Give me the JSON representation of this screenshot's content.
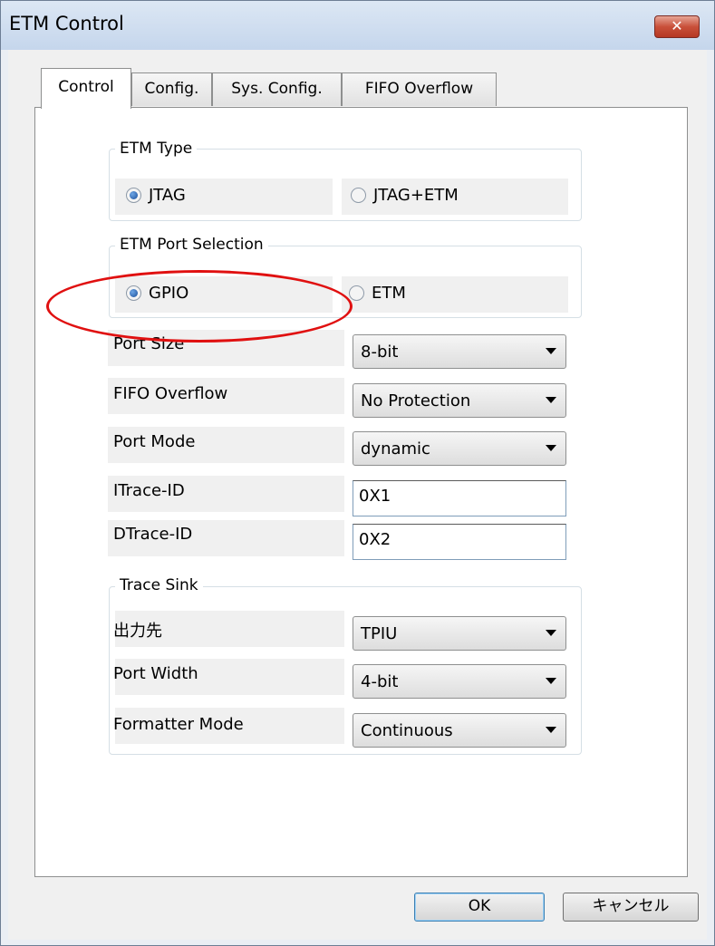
{
  "window": {
    "title": "ETM Control",
    "close_glyph": "✕"
  },
  "tabs": [
    {
      "label": "Control",
      "active": true
    },
    {
      "label": "Config.",
      "active": false
    },
    {
      "label": "Sys. Config.",
      "active": false
    },
    {
      "label": "FIFO Overflow",
      "active": false
    }
  ],
  "etm_type": {
    "title": "ETM Type",
    "options": [
      {
        "label": "JTAG",
        "checked": true
      },
      {
        "label": "JTAG+ETM",
        "checked": false
      }
    ]
  },
  "port_selection": {
    "title": "ETM Port Selection",
    "options": [
      {
        "label": "GPIO",
        "checked": true
      },
      {
        "label": "ETM",
        "checked": false
      }
    ],
    "highlight_color": "#e01010"
  },
  "settings": {
    "port_size": {
      "label": "Port Size",
      "value": "8-bit"
    },
    "fifo_overflow": {
      "label": "FIFO Overflow",
      "value": "No Protection"
    },
    "port_mode": {
      "label": "Port Mode",
      "value": "dynamic"
    },
    "itrace_id": {
      "label": "ITrace-ID",
      "value": "0X1"
    },
    "dtrace_id": {
      "label": "DTrace-ID",
      "value": "0X2"
    }
  },
  "trace_sink": {
    "title": "Trace Sink",
    "output": {
      "label": "出力先",
      "value": "TPIU"
    },
    "port_width": {
      "label": "Port Width",
      "value": "4-bit"
    },
    "formatter_mode": {
      "label": "Formatter Mode",
      "value": "Continuous"
    }
  },
  "buttons": {
    "ok": "OK",
    "cancel": "キャンセル"
  }
}
